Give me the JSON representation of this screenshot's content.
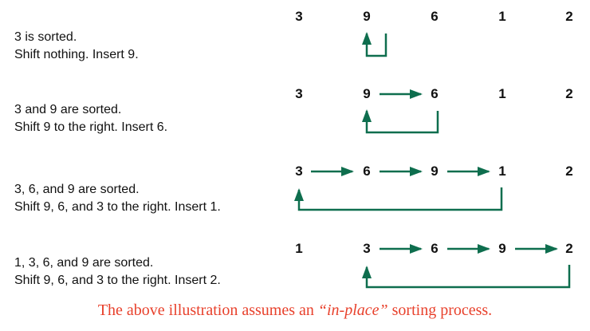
{
  "colors": {
    "arrow": "#0e6e4e",
    "caption": "#e8412c",
    "text": "#111111"
  },
  "steps": [
    {
      "line1": "3 is sorted.",
      "line2": "Shift nothing. Insert 9.",
      "numbers": [
        "3",
        "9",
        "6",
        "1",
        "2"
      ]
    },
    {
      "line1": "3 and 9 are sorted.",
      "line2": "Shift 9 to the right. Insert 6.",
      "numbers": [
        "3",
        "9",
        "6",
        "1",
        "2"
      ]
    },
    {
      "line1": "3, 6, and 9 are sorted.",
      "line2": "Shift 9, 6, and 3 to the right. Insert 1.",
      "numbers": [
        "3",
        "6",
        "9",
        "1",
        "2"
      ]
    },
    {
      "line1": "1, 3, 6, and 9 are sorted.",
      "line2": "Shift 9, 6, and 3 to the right. Insert 2.",
      "numbers": [
        "1",
        "3",
        "6",
        "9",
        "2"
      ]
    }
  ],
  "caption": {
    "before": "The above illustration assumes an ",
    "emphasis": "“in-place”",
    "after": " sorting process."
  }
}
